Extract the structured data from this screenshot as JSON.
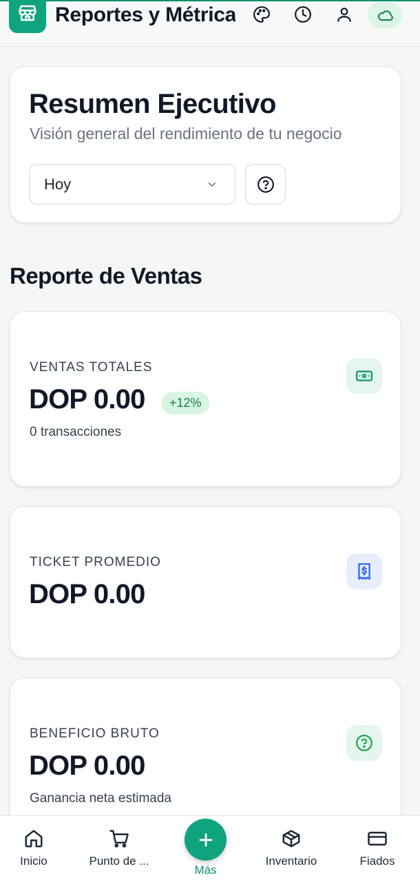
{
  "header": {
    "title": "Reportes y Métricas",
    "icons": [
      "store-icon",
      "palette-icon",
      "clock-icon",
      "user-icon",
      "cloud-icon"
    ]
  },
  "summary": {
    "title": "Resumen Ejecutivo",
    "subtitle": "Visión general del rendimiento de tu negocio",
    "period_select": {
      "value": "Hoy"
    }
  },
  "sales_report": {
    "title": "Reporte de Ventas",
    "metrics": [
      {
        "label": "VENTAS TOTALES",
        "value": "DOP 0.00",
        "badge": "+12%",
        "sub": "0 transacciones",
        "icon": "banknote-icon"
      },
      {
        "label": "TICKET PROMEDIO",
        "value": "DOP 0.00",
        "icon": "receipt-icon"
      },
      {
        "label": "BENEFICIO BRUTO",
        "value": "DOP 0.00",
        "sub": "Ganancia neta estimada",
        "icon": "help-circle-icon"
      }
    ]
  },
  "bottom_nav": {
    "items": [
      {
        "label": "Inicio",
        "icon": "home-icon"
      },
      {
        "label": "Punto de ...",
        "icon": "cart-icon"
      },
      {
        "label": "Más",
        "icon": "plus-icon"
      },
      {
        "label": "Inventario",
        "icon": "box-icon"
      },
      {
        "label": "Fiados",
        "icon": "credit-card-icon"
      }
    ]
  },
  "colors": {
    "primary": "#10a37f",
    "badge_bg": "#d8f5e3",
    "badge_text": "#15803d",
    "background": "#f4f7f6"
  }
}
